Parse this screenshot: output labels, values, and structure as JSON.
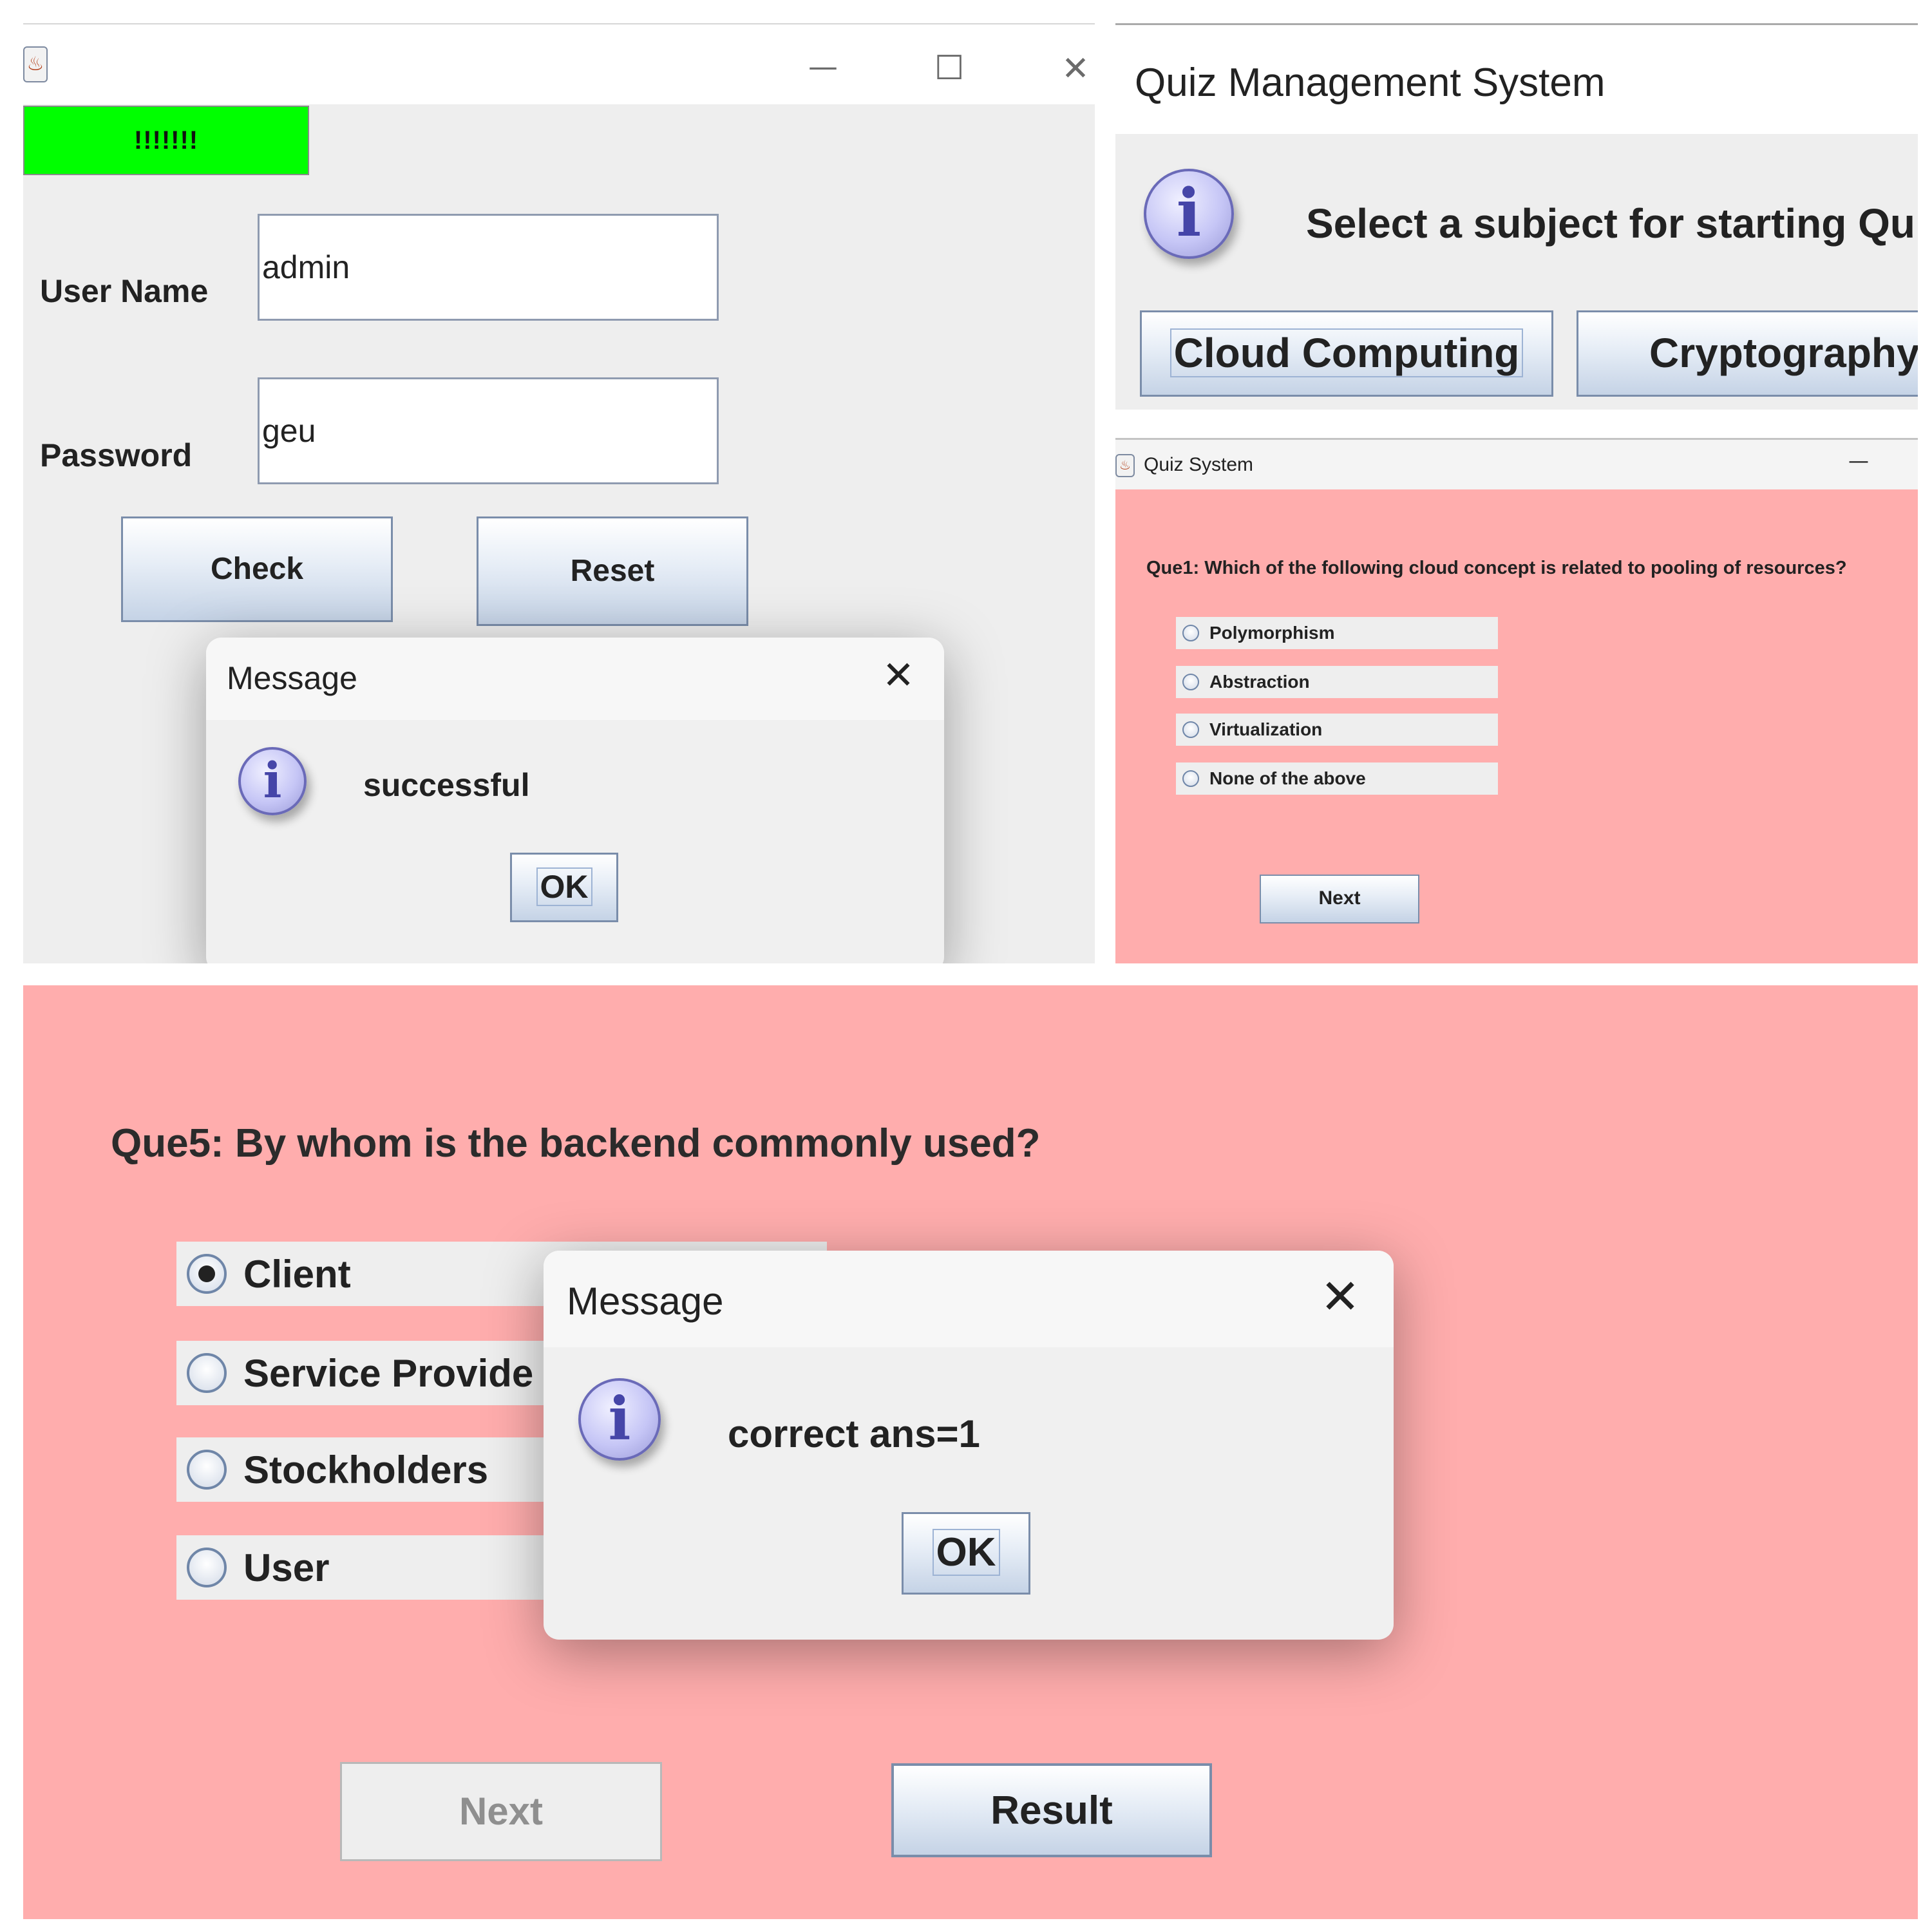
{
  "login": {
    "status_label": "!!!!!!!",
    "username_label": "User Name",
    "username_value": "admin",
    "password_label": "Password",
    "password_value": "geu",
    "check_button": "Check",
    "reset_button": "Reset",
    "dialog": {
      "title": "Message",
      "message": "successful",
      "ok": "OK"
    }
  },
  "subject": {
    "window_title": "Quiz Management System",
    "prompt": "Select a subject for starting Qui",
    "buttons": [
      "Cloud Computing",
      "Cryptography"
    ]
  },
  "quiz1": {
    "window_title": "Quiz System",
    "question": "Que1: Which of the following cloud concept is related to pooling of resources?",
    "options": [
      "Polymorphism",
      "Abstraction",
      "Virtualization",
      "None of the above"
    ],
    "next_button": "Next"
  },
  "quiz5": {
    "question": "Que5: By whom is the backend commonly used?",
    "options": [
      "Client",
      "Service Provide",
      "Stockholders",
      "User"
    ],
    "selected_index": 0,
    "next_button": "Next",
    "result_button": "Result",
    "dialog": {
      "title": "Message",
      "message": "correct ans=1",
      "ok": "OK"
    }
  },
  "icons": {
    "info": "i",
    "java": "java-cup-icon",
    "minimize": "—",
    "maximize": "☐",
    "close": "✕"
  },
  "colors": {
    "quiz_background": "#ffadad",
    "status_green": "#00ff00"
  }
}
